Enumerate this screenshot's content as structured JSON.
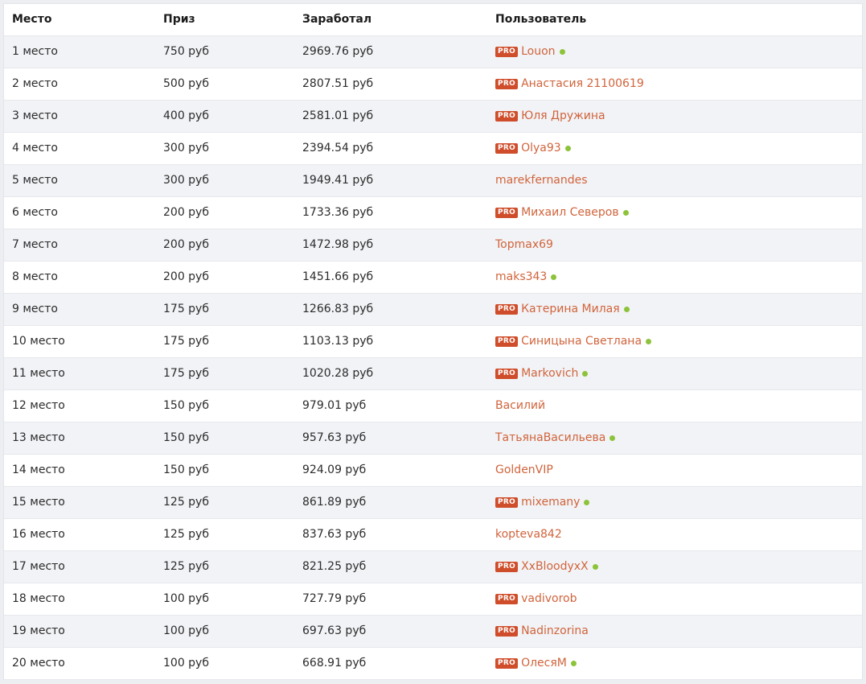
{
  "colors": {
    "pro_badge_bg": "#cf4d2a",
    "username": "#d0643c",
    "online_dot": "#8dc33a",
    "row_alt": "#f2f3f6"
  },
  "headers": {
    "place": "Место",
    "prize": "Приз",
    "earned": "Заработал",
    "user": "Пользователь"
  },
  "pro_label": "PRO",
  "rows": [
    {
      "place": "1 место",
      "prize": "750 руб",
      "earned": "2969.76 руб",
      "user": "Louon",
      "pro": true,
      "online": true
    },
    {
      "place": "2 место",
      "prize": "500 руб",
      "earned": "2807.51 руб",
      "user": "Анастасия 21100619",
      "pro": true,
      "online": false
    },
    {
      "place": "3 место",
      "prize": "400 руб",
      "earned": "2581.01 руб",
      "user": "Юля Дружина",
      "pro": true,
      "online": false
    },
    {
      "place": "4 место",
      "prize": "300 руб",
      "earned": "2394.54 руб",
      "user": "Olya93",
      "pro": true,
      "online": true
    },
    {
      "place": "5 место",
      "prize": "300 руб",
      "earned": "1949.41 руб",
      "user": "marekfernandes",
      "pro": false,
      "online": false
    },
    {
      "place": "6 место",
      "prize": "200 руб",
      "earned": "1733.36 руб",
      "user": "Михаил Северов",
      "pro": true,
      "online": true
    },
    {
      "place": "7 место",
      "prize": "200 руб",
      "earned": "1472.98 руб",
      "user": "Topmax69",
      "pro": false,
      "online": false
    },
    {
      "place": "8 место",
      "prize": "200 руб",
      "earned": "1451.66 руб",
      "user": "maks343",
      "pro": false,
      "online": true
    },
    {
      "place": "9 место",
      "prize": "175 руб",
      "earned": "1266.83 руб",
      "user": "Катерина Милая",
      "pro": true,
      "online": true
    },
    {
      "place": "10 место",
      "prize": "175 руб",
      "earned": "1103.13 руб",
      "user": "Синицына Светлана",
      "pro": true,
      "online": true
    },
    {
      "place": "11 место",
      "prize": "175 руб",
      "earned": "1020.28 руб",
      "user": "Markovich",
      "pro": true,
      "online": true
    },
    {
      "place": "12 место",
      "prize": "150 руб",
      "earned": "979.01 руб",
      "user": "Василий",
      "pro": false,
      "online": false
    },
    {
      "place": "13 место",
      "prize": "150 руб",
      "earned": "957.63 руб",
      "user": "ТатьянаВасильева",
      "pro": false,
      "online": true
    },
    {
      "place": "14 место",
      "prize": "150 руб",
      "earned": "924.09 руб",
      "user": "GoldenVIP",
      "pro": false,
      "online": false
    },
    {
      "place": "15 место",
      "prize": "125 руб",
      "earned": "861.89 руб",
      "user": "mixemany",
      "pro": true,
      "online": true
    },
    {
      "place": "16 место",
      "prize": "125 руб",
      "earned": "837.63 руб",
      "user": "kopteva842",
      "pro": false,
      "online": false
    },
    {
      "place": "17 место",
      "prize": "125 руб",
      "earned": "821.25 руб",
      "user": "XxBloodyxX",
      "pro": true,
      "online": true
    },
    {
      "place": "18 место",
      "prize": "100 руб",
      "earned": "727.79 руб",
      "user": "vadivorob",
      "pro": true,
      "online": false
    },
    {
      "place": "19 место",
      "prize": "100 руб",
      "earned": "697.63 руб",
      "user": "Nadinzorina",
      "pro": true,
      "online": false
    },
    {
      "place": "20 место",
      "prize": "100 руб",
      "earned": "668.91 руб",
      "user": "ОлесяМ",
      "pro": true,
      "online": true
    }
  ]
}
